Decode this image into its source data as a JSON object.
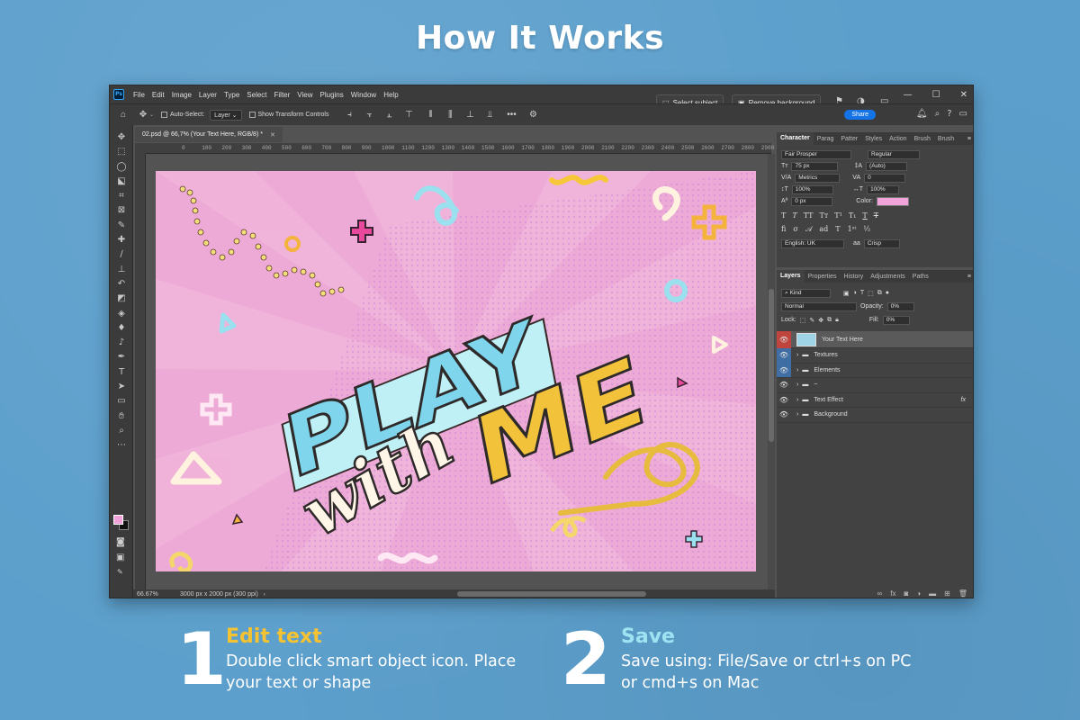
{
  "headline": "How It Works",
  "app": {
    "menu": [
      "File",
      "Edit",
      "Image",
      "Layer",
      "Type",
      "Select",
      "Filter",
      "View",
      "Plugins",
      "Window",
      "Help"
    ],
    "buttons": {
      "select_subject": "Select subject",
      "remove_background": "Remove background",
      "share": "Share"
    },
    "options_bar": {
      "auto_select": "Auto-Select:",
      "auto_select_value": "Layer",
      "show_transform": "Show Transform Controls"
    },
    "doc_tab": "02.psd @ 66,7% (Your Text Here, RGB/8) *",
    "ruler_ticks": [
      "0",
      "100",
      "200",
      "300",
      "400",
      "500",
      "600",
      "700",
      "800",
      "900",
      "1000",
      "1100",
      "1200",
      "1300",
      "1400",
      "1500",
      "1600",
      "1700",
      "1800",
      "1900",
      "2000",
      "2100",
      "2200",
      "2300",
      "2400",
      "2500",
      "2600",
      "2700",
      "2800",
      "2900",
      "300"
    ],
    "status": {
      "zoom": "66.67%",
      "doc_info": "3000 px x 2000 px (300 ppi)"
    }
  },
  "artwork": {
    "word1": "PLAY",
    "word2": "with",
    "word3": "ME"
  },
  "character_panel": {
    "tabs": [
      "Character",
      "Parag",
      "Patter",
      "Styles",
      "Action",
      "Brush",
      "Brush"
    ],
    "font_family": "Fair Prosper",
    "font_style": "Regular",
    "font_size": "75 px",
    "leading": "(Auto)",
    "kerning": "Metrics",
    "tracking": "0",
    "vscale": "100%",
    "hscale": "100%",
    "baseline": "0 px",
    "color_label": "Color:",
    "color_value": "#f0a3d8",
    "language": "English: UK",
    "aa_label": "a",
    "antialias": "Crisp"
  },
  "layers_panel": {
    "tabs": [
      "Layers",
      "Properties",
      "History",
      "Adjustments",
      "Paths"
    ],
    "filter": "Kind",
    "blend_mode": "Normal",
    "opacity_label": "Opacity:",
    "opacity": "0%",
    "lock_label": "Lock:",
    "fill_label": "Fill:",
    "fill": "0%",
    "fx": "fx",
    "layers": [
      {
        "name": "Your Text Here",
        "type": "smart"
      },
      {
        "name": "Textures",
        "type": "folder"
      },
      {
        "name": "Elements",
        "type": "folder"
      },
      {
        "name": "~",
        "type": "folder"
      },
      {
        "name": "Text Effect",
        "type": "folder"
      },
      {
        "name": "Background",
        "type": "folder"
      }
    ]
  },
  "steps": [
    {
      "number": "1",
      "title": "Edit text",
      "line1": "Double click smart object icon. Place",
      "line2": "your text or shape"
    },
    {
      "number": "2",
      "title": "Save",
      "line1": "Save using: File/Save or ctrl+s on PC",
      "line2": "or cmd+s on Mac"
    }
  ],
  "colors": {
    "step1_title": "#f5c231",
    "step2_title": "#9ee3f2",
    "accent_blue": "#1473e6",
    "layer_eye_red": "#c0443e",
    "layer_eye_blue": "#3e6ea3"
  }
}
